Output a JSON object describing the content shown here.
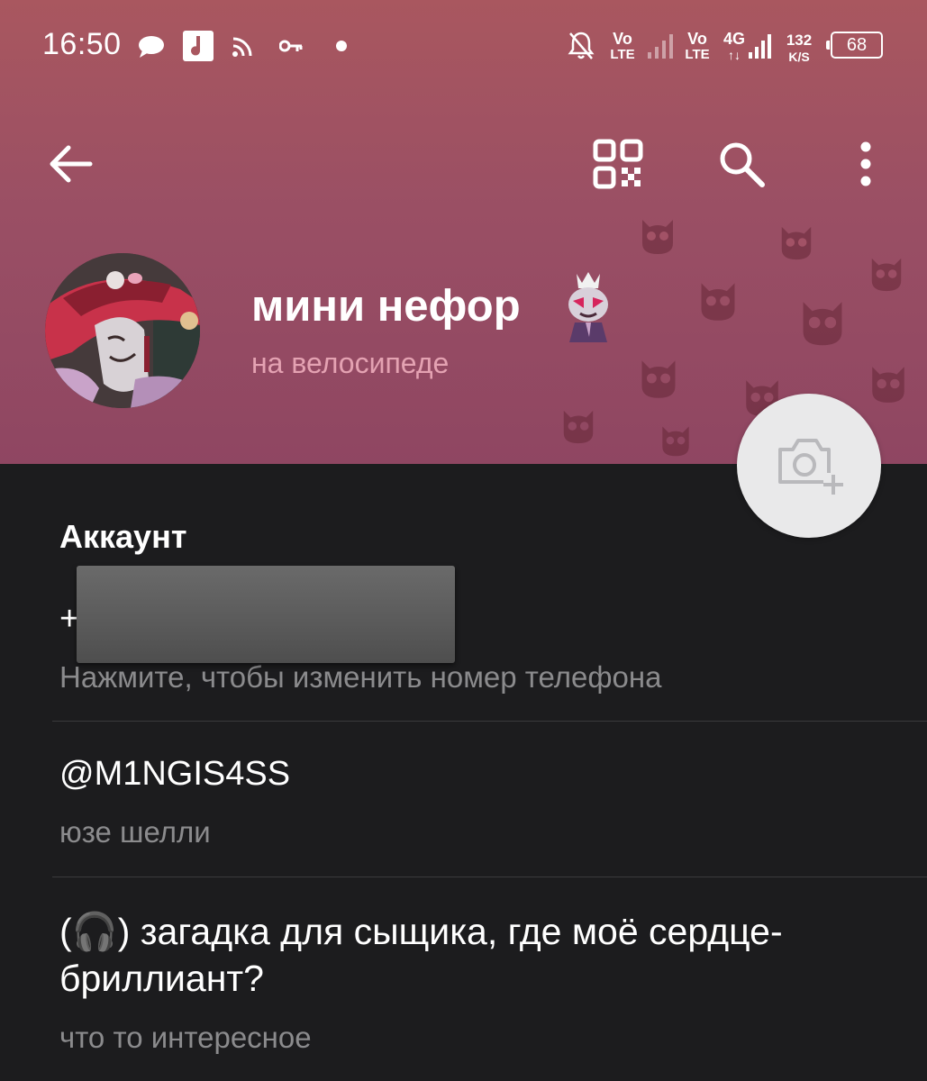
{
  "status_bar": {
    "time": "16:50",
    "sim1_volte": "Vo",
    "sim1_lte": "LTE",
    "sim2_volte": "Vo",
    "sim2_lte": "LTE",
    "network_type": "4G",
    "data_arrows": "↑↓",
    "speed_value": "132",
    "speed_unit": "K/S",
    "battery": "68",
    "icons": [
      "message-icon",
      "music-app-icon",
      "cast-icon",
      "vpn-key-icon",
      "dot-icon",
      "bell-muted-icon",
      "signal-icon",
      "signal-icon"
    ]
  },
  "toolbar": {
    "back_icon": "arrow-left-icon",
    "qr_icon": "qr-code-icon",
    "search_icon": "search-icon",
    "menu_icon": "more-vertical-icon"
  },
  "profile": {
    "name": "мини нефор",
    "status": "на велосипеде",
    "camera_icon": "camera-add-icon"
  },
  "account": {
    "section_title": "Аккаунт",
    "phone_prefix": "+",
    "phone_hint": "Нажмите, чтобы изменить номер телефона",
    "username": "@M1NGIS4SS",
    "username_hint": "юзе шелли",
    "bio": "(🎧) загадка для сыщика, где моё сердце-бриллиант?",
    "bio_hint": "что то интересное"
  },
  "colors": {
    "header_top": "#a9575f",
    "header_bottom": "#8f4662",
    "status_text": "#e4a2b2",
    "background": "#1c1c1e",
    "hint_text": "#8b8b8d"
  }
}
